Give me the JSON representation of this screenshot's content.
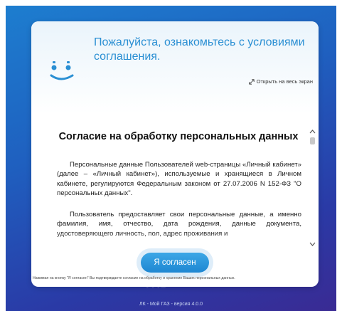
{
  "header": {
    "title": "Пожалуйста, ознакомьтесь с условиями соглашения.",
    "fullscreen_link": "Открыть на весь экран"
  },
  "document": {
    "title": "Согласие на обработку персональных данных",
    "paragraphs": [
      "Персональные данные Пользователей web-страницы «Личный кабинет» (далее – «Личный кабинет»), используемые и хранящиеся в Личном кабинете, регулируются Федеральным законом от 27.07.2006 N 152-ФЗ \"О персональных данных\".",
      "Пользователь предоставляет свои персональные данные, а именно фамилия, имя, отчество, дата рождения, данные документа, удостоверяющего личность, пол, адрес проживания и"
    ]
  },
  "actions": {
    "agree_label": "Я согласен"
  },
  "footnote": "Нажимая на кнопку \"Я согласен\" Вы подтверждаете согласие на обработку и хранение Ваших персональных данных.",
  "footer": {
    "version": "ЛК - Мой ГАЗ - версия 4.0.0"
  },
  "icons": {
    "mascot": "smiley-face-icon",
    "fullscreen": "expand-icon",
    "scroll_up": "chevron-up-icon",
    "scroll_down": "chevron-down-icon"
  },
  "colors": {
    "accent": "#2a8fd3",
    "button": "#1e87d2",
    "background_top": "#1d7fd0",
    "background_bottom": "#3a2a93"
  }
}
